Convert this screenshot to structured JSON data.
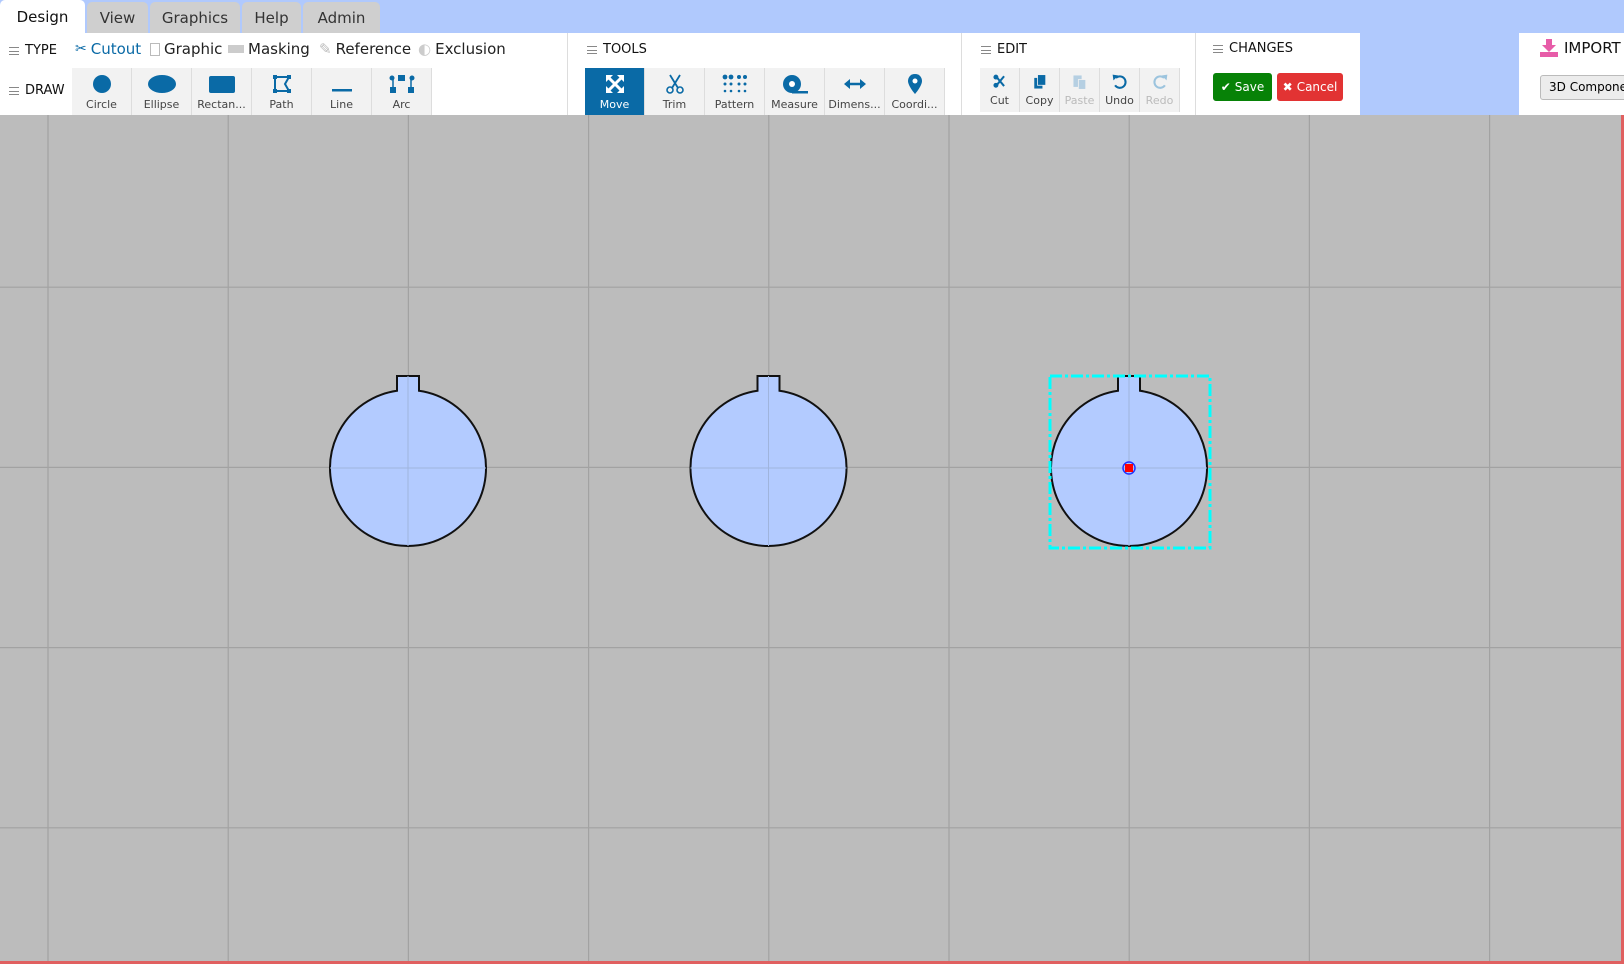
{
  "tabs": [
    {
      "label": "Design",
      "active": true
    },
    {
      "label": "View"
    },
    {
      "label": "Graphics"
    },
    {
      "label": "Help"
    },
    {
      "label": "Admin"
    }
  ],
  "type_section": {
    "label": "TYPE",
    "items": [
      {
        "label": "Cutout",
        "icon": "scissors-icon",
        "active": true
      },
      {
        "label": "Graphic",
        "icon": "file-image-icon"
      },
      {
        "label": "Masking",
        "icon": "masking-icon"
      },
      {
        "label": "Reference",
        "icon": "edit-icon"
      },
      {
        "label": "Exclusion",
        "icon": "half-circle-icon"
      }
    ]
  },
  "draw_section": {
    "label": "DRAW",
    "items": [
      {
        "label": "Circle",
        "icon": "circle-icon"
      },
      {
        "label": "Ellipse",
        "icon": "ellipse-icon"
      },
      {
        "label": "Rectan...",
        "icon": "rectangle-icon"
      },
      {
        "label": "Path",
        "icon": "path-icon"
      },
      {
        "label": "Line",
        "icon": "line-icon"
      },
      {
        "label": "Arc",
        "icon": "arc-icon"
      }
    ]
  },
  "tools_section": {
    "label": "TOOLS",
    "items": [
      {
        "label": "Move",
        "icon": "move-icon",
        "selected": true
      },
      {
        "label": "Trim",
        "icon": "scissors-icon"
      },
      {
        "label": "Pattern",
        "icon": "pattern-icon"
      },
      {
        "label": "Measure",
        "icon": "tape-measure-icon"
      },
      {
        "label": "Dimens...",
        "icon": "dimension-arrow-icon"
      },
      {
        "label": "Coordi...",
        "icon": "map-pin-icon"
      }
    ]
  },
  "edit_section": {
    "label": "EDIT",
    "items": [
      {
        "label": "Cut",
        "icon": "scissors-icon"
      },
      {
        "label": "Copy",
        "icon": "copy-icon"
      },
      {
        "label": "Paste",
        "icon": "paste-icon",
        "disabled": true
      },
      {
        "label": "Undo",
        "icon": "undo-icon"
      },
      {
        "label": "Redo",
        "icon": "redo-icon",
        "disabled": true
      }
    ]
  },
  "changes_section": {
    "label": "CHANGES",
    "save_label": "Save",
    "cancel_label": "Cancel"
  },
  "import_section": {
    "label": "IMPORT",
    "button_label": "3D Componen"
  },
  "colors": {
    "accent": "#0a6aa6",
    "save": "#078207",
    "cancel": "#e23333",
    "shape_fill": "#b3cbff",
    "selection": "#00ffff",
    "canvas": "#bcbcbc",
    "header": "#b0c9fd"
  },
  "canvas": {
    "shapes": [
      {
        "type": "keyed-circle",
        "selected": false
      },
      {
        "type": "keyed-circle",
        "selected": false
      },
      {
        "type": "keyed-circle",
        "selected": true
      }
    ]
  }
}
